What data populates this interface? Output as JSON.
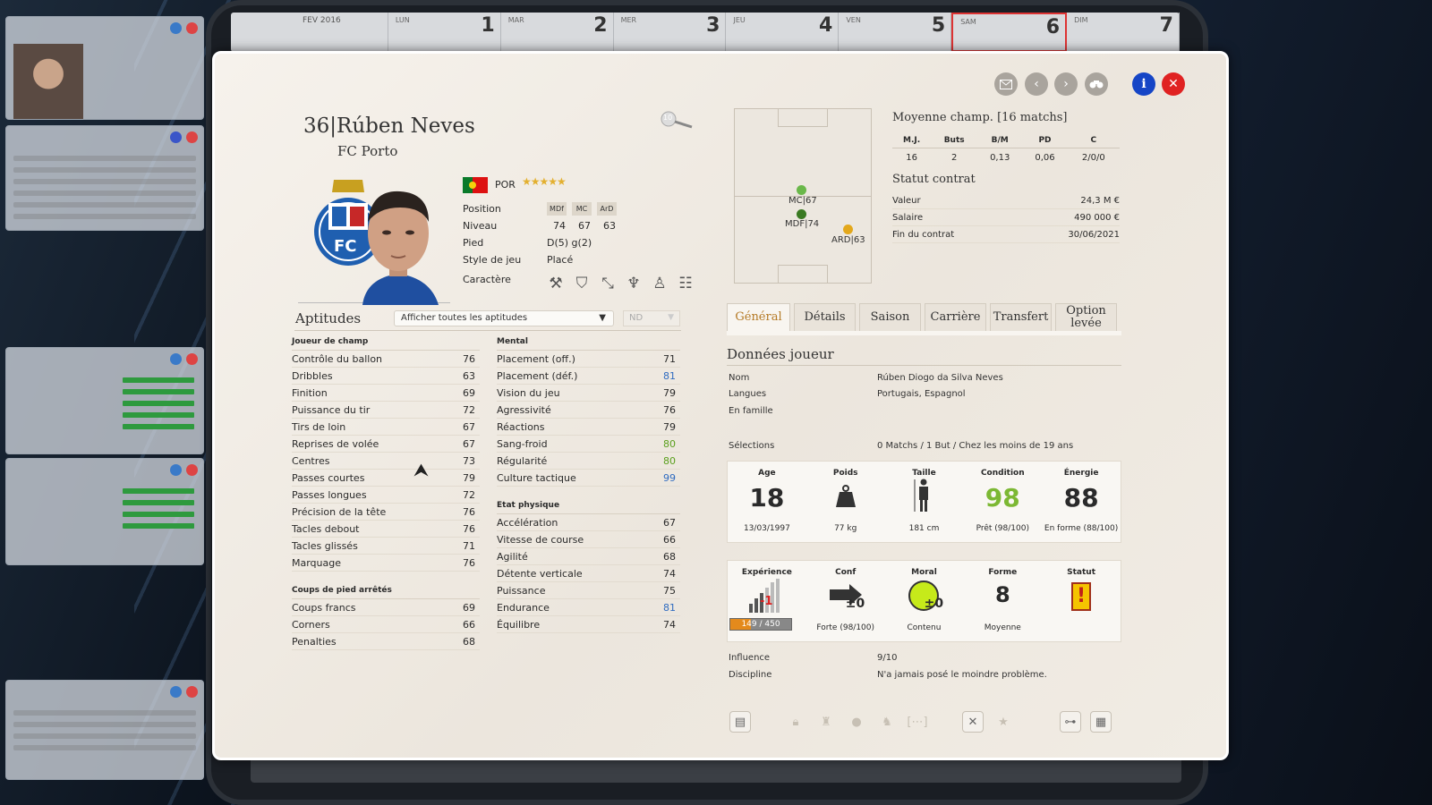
{
  "background": {
    "calendar": {
      "month": "FEV 2016",
      "days": [
        {
          "name": "LUN",
          "num": "1"
        },
        {
          "name": "MAR",
          "num": "2"
        },
        {
          "name": "MER",
          "num": "3"
        },
        {
          "name": "JEU",
          "num": "4"
        },
        {
          "name": "VEN",
          "num": "5"
        },
        {
          "name": "SAM",
          "num": "6"
        },
        {
          "name": "DIM",
          "num": "7"
        }
      ]
    }
  },
  "header": {
    "number": "36|",
    "name": "Rúben Neves",
    "club": "FC Porto",
    "zoom": "10"
  },
  "player": {
    "nationality": "POR",
    "stars": "★★★★★",
    "labels": {
      "position": "Position",
      "niveau": "Niveau",
      "pied": "Pied",
      "style": "Style de jeu",
      "caractere": "Caractère"
    },
    "positions": [
      "MDf",
      "MC",
      "ArD"
    ],
    "levels": [
      "74",
      "67",
      "63"
    ],
    "pied": "D(5) g(2)",
    "style": "Placé"
  },
  "aptitudes": {
    "title": "Aptitudes",
    "filter": "Afficher toutes les aptitudes",
    "nd": "ND",
    "joueur_title": "Joueur de champ",
    "joueur": [
      {
        "n": "Contrôle du ballon",
        "v": "76"
      },
      {
        "n": "Dribbles",
        "v": "63"
      },
      {
        "n": "Finition",
        "v": "69"
      },
      {
        "n": "Puissance du tir",
        "v": "72"
      },
      {
        "n": "Tirs de loin",
        "v": "67"
      },
      {
        "n": "Reprises de volée",
        "v": "67"
      },
      {
        "n": "Centres",
        "v": "73"
      },
      {
        "n": "Passes courtes",
        "v": "79"
      },
      {
        "n": "Passes longues",
        "v": "72"
      },
      {
        "n": "Précision de la tête",
        "v": "76"
      },
      {
        "n": "Tacles debout",
        "v": "76"
      },
      {
        "n": "Tacles glissés",
        "v": "71"
      },
      {
        "n": "Marquage",
        "v": "76"
      }
    ],
    "coups_title": "Coups de pied arrêtés",
    "coups": [
      {
        "n": "Coups francs",
        "v": "69"
      },
      {
        "n": "Corners",
        "v": "66"
      },
      {
        "n": "Penalties",
        "v": "68"
      }
    ],
    "mental_title": "Mental",
    "mental": [
      {
        "n": "Placement (off.)",
        "v": "71",
        "c": ""
      },
      {
        "n": "Placement (déf.)",
        "v": "81",
        "c": "b"
      },
      {
        "n": "Vision du jeu",
        "v": "79",
        "c": ""
      },
      {
        "n": "Agressivité",
        "v": "76",
        "c": ""
      },
      {
        "n": "Réactions",
        "v": "79",
        "c": ""
      },
      {
        "n": "Sang-froid",
        "v": "80",
        "c": "g"
      },
      {
        "n": "Régularité",
        "v": "80",
        "c": "g"
      },
      {
        "n": "Culture tactique",
        "v": "99",
        "c": "b"
      }
    ],
    "physique_title": "Etat physique",
    "physique": [
      {
        "n": "Accélération",
        "v": "67",
        "c": ""
      },
      {
        "n": "Vitesse de course",
        "v": "66",
        "c": ""
      },
      {
        "n": "Agilité",
        "v": "68",
        "c": ""
      },
      {
        "n": "Détente verticale",
        "v": "74",
        "c": ""
      },
      {
        "n": "Puissance",
        "v": "75",
        "c": ""
      },
      {
        "n": "Endurance",
        "v": "81",
        "c": "b"
      },
      {
        "n": "Équilibre",
        "v": "74",
        "c": ""
      }
    ]
  },
  "pitch": {
    "positions": [
      {
        "label": "MC|67",
        "color": "#6ab84a"
      },
      {
        "label": "MDF|74",
        "color": "#3a7a22"
      },
      {
        "label": "ARD|63",
        "color": "#e3a81c"
      }
    ]
  },
  "moyenne": {
    "title": "Moyenne champ. [16 matchs]",
    "headers": [
      "M.J.",
      "Buts",
      "B/M",
      "PD",
      "C"
    ],
    "values": [
      "16",
      "2",
      "0,13",
      "0,06",
      "2/0/0"
    ]
  },
  "contrat": {
    "title": "Statut contrat",
    "rows": [
      {
        "k": "Valeur",
        "v": "24,3 M €"
      },
      {
        "k": "Salaire",
        "v": "490 000 €"
      },
      {
        "k": "Fin du contrat",
        "v": "30/06/2021"
      }
    ]
  },
  "tabs": [
    "Général",
    "Détails",
    "Saison",
    "Carrière",
    "Transfert",
    "Option levée"
  ],
  "donnees": {
    "title": "Données joueur",
    "rows": [
      {
        "k": "Nom",
        "v": "Rúben Diogo da Silva Neves"
      },
      {
        "k": "Langues",
        "v": "Portugais, Espagnol"
      },
      {
        "k": "En famille",
        "v": ""
      }
    ],
    "selections_k": "Sélections",
    "selections_v": "0 Matchs / 1 But / Chez les moins de 19 ans"
  },
  "stats1": [
    {
      "t": "Age",
      "big": "18",
      "sub": "13/03/1997",
      "color": "#333"
    },
    {
      "t": "Poids",
      "big": "",
      "sub": "77 kg",
      "color": "#333",
      "icon": "weight-icon"
    },
    {
      "t": "Taille",
      "big": "",
      "sub": "181 cm",
      "color": "#333",
      "icon": "height-icon"
    },
    {
      "t": "Condition",
      "big": "98",
      "sub": "Prêt (98/100)",
      "color": "#7cb833"
    },
    {
      "t": "Énergie",
      "big": "88",
      "sub": "En forme (88/100)",
      "color": "#333"
    }
  ],
  "stats2": {
    "experience": {
      "t": "Expérience",
      "badge": "-1",
      "bar": "149 / 450",
      "progress": 0.331
    },
    "conf": {
      "t": "Conf",
      "badge": "±0",
      "sub": "Forte (98/100)"
    },
    "moral": {
      "t": "Moral",
      "badge": "±0",
      "sub": "Contenu"
    },
    "forme": {
      "t": "Forme",
      "big": "8",
      "sub": "Moyenne"
    },
    "statut": {
      "t": "Statut",
      "mark": "!"
    }
  },
  "extra": [
    {
      "k": "Influence",
      "v": "9/10"
    },
    {
      "k": "Discipline",
      "v": "N'a jamais posé le moindre problème."
    }
  ]
}
